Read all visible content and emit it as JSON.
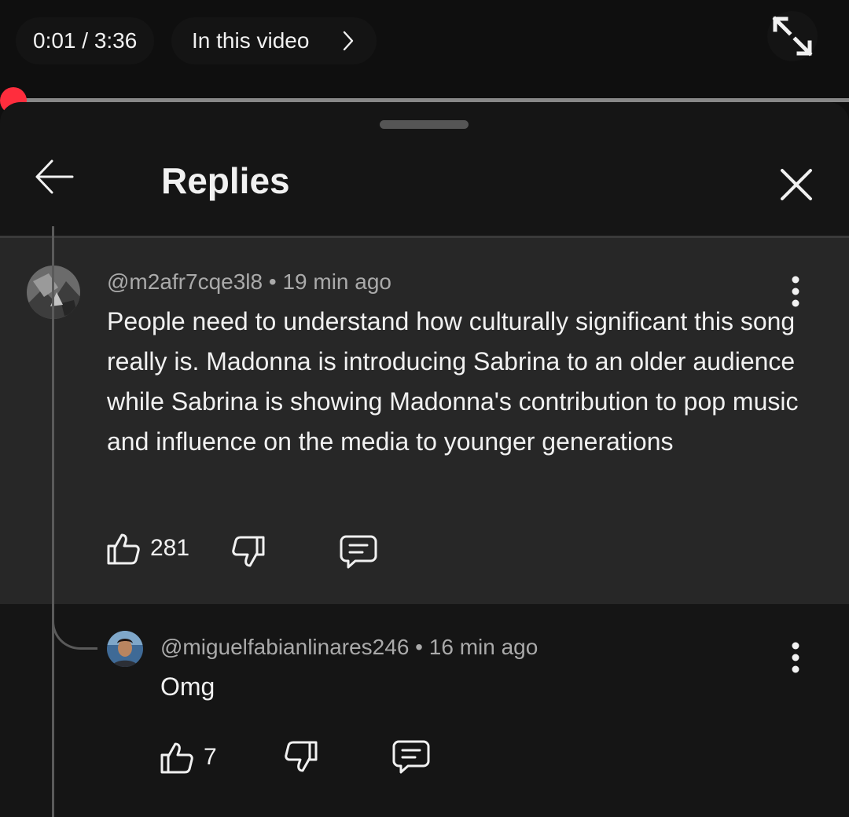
{
  "player": {
    "time": "0:01 / 3:36",
    "chapter_label": "In this video",
    "progress_fraction": 0.0046
  },
  "panel": {
    "title": "Replies"
  },
  "parent_comment": {
    "author": "@m2afr7cqe3l8",
    "separator": " • ",
    "time_ago": "19 min ago",
    "text": "People need to understand how culturally significant this song really is. Madonna is introducing Sabrina to an older audience while Sabrina is showing Madonna's contribution to pop music and influence on the media to younger generations",
    "likes": "281"
  },
  "reply": {
    "author": "@miguelfabianlinares246",
    "separator": " • ",
    "time_ago": "16 min ago",
    "text": "Omg",
    "likes": "7"
  },
  "icons": {
    "back": "arrow-left-icon",
    "close": "close-icon",
    "fullscreen": "exit-fullscreen-icon",
    "like": "thumbs-up-icon",
    "dislike": "thumbs-down-icon",
    "reply": "comment-icon",
    "more": "more-vertical-icon",
    "chapter": "chevron-right-icon"
  },
  "colors": {
    "accent": "#ff0033",
    "background": "#0f0f0f",
    "highlighted_comment": "#272727"
  }
}
